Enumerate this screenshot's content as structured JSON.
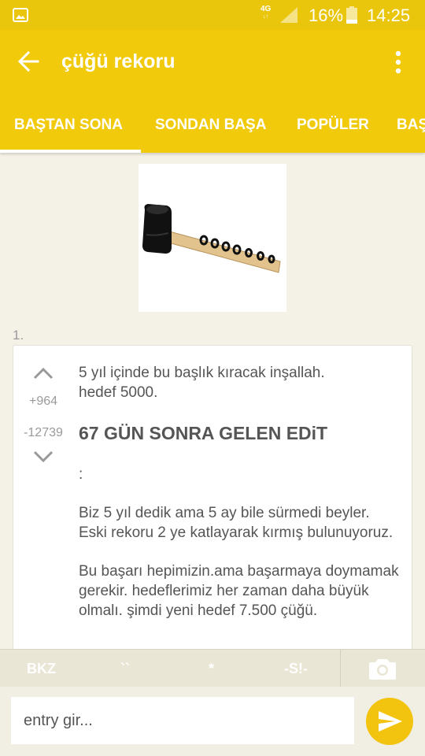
{
  "status_bar": {
    "network": "4G",
    "network_sub": "↓↑",
    "battery": "16%",
    "time": "14:25"
  },
  "app_bar": {
    "title": "çüğü rekoru"
  },
  "tabs": [
    {
      "label": "BAŞTAN SONA",
      "active": true
    },
    {
      "label": "SONDAN BAŞA",
      "active": false
    },
    {
      "label": "POPÜLER",
      "active": false
    },
    {
      "label": "BAŞ",
      "active": false
    }
  ],
  "entry": {
    "number": "1.",
    "up_count": "+964",
    "down_count": "-12739",
    "text_intro": "5 yıl içinde bu başlık kıracak inşallah. hedef 5000.",
    "heading": "67 GÜN SONRA GELEN EDiT",
    "colon": ":",
    "para2": "Biz 5 yıl dedik ama 5 ay bile sürmedi beyler. Eski rekoru 2 ye katlayarak kırmış bulunuyoruz.",
    "para3": "Bu başarı hepimizin.ama başarmaya doymamak gerekir. hedeflerimiz her zaman daha büyük olmalı. şimdi yeni hedef 7.500 çüğü."
  },
  "toolbar": {
    "bkz": "BKZ",
    "backtick": "``",
    "star": "*",
    "spoiler": "-S!-"
  },
  "composer": {
    "placeholder": "entry gir..."
  },
  "colors": {
    "accent": "#f0ca0b",
    "status_bar": "#e9c50b",
    "background": "#f4f1e6"
  },
  "icons": {
    "image": "image-icon",
    "signal": "signal-icon",
    "battery": "battery-icon",
    "back": "arrow-back-icon",
    "more": "more-vert-icon",
    "up": "chevron-up-icon",
    "down": "chevron-down-icon",
    "camera": "camera-icon",
    "send": "send-icon"
  }
}
